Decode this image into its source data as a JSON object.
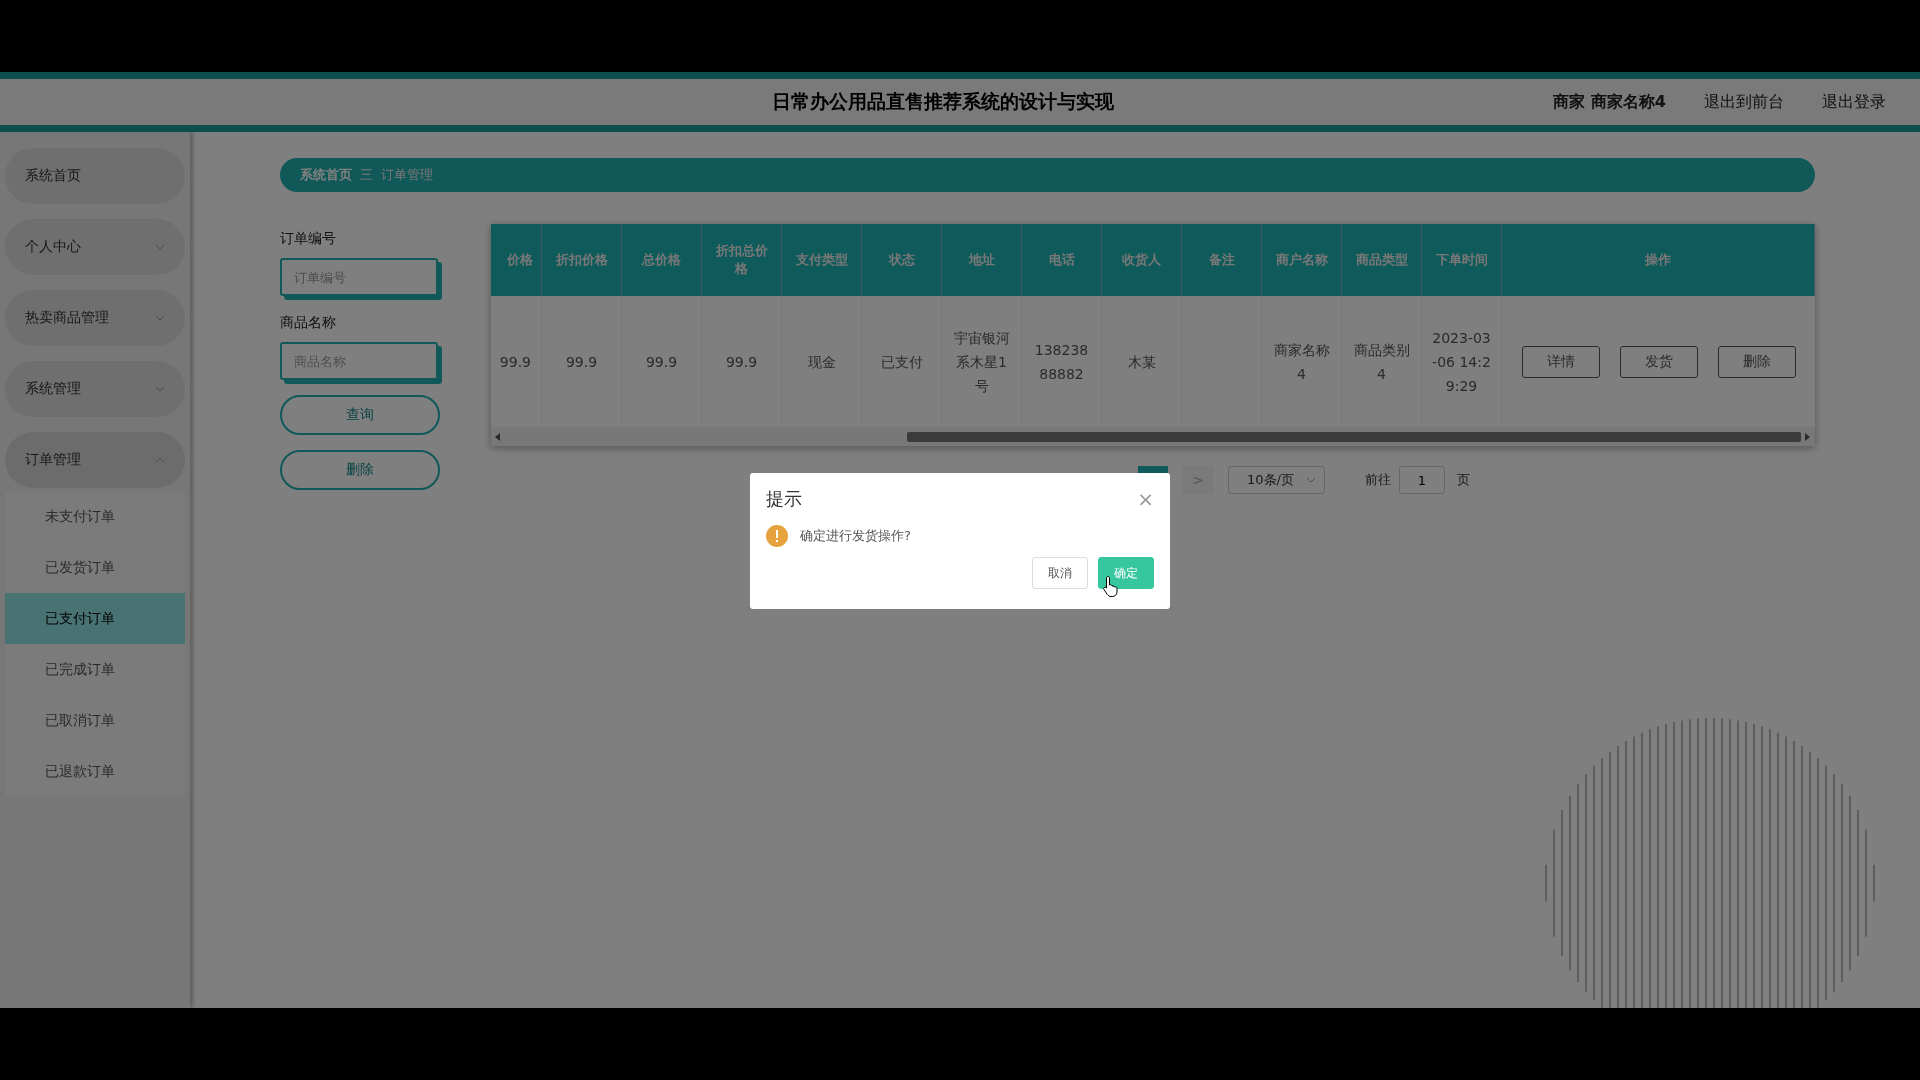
{
  "header": {
    "title": "日常办公用品直售推荐系统的设计与实现",
    "user": "商家 商家名称4",
    "links": [
      "退出到前台",
      "退出登录"
    ]
  },
  "sidebar": {
    "items": [
      {
        "label": "系统首页"
      },
      {
        "label": "个人中心",
        "expanded": false
      },
      {
        "label": "热卖商品管理",
        "expanded": false
      },
      {
        "label": "系统管理",
        "expanded": false
      },
      {
        "label": "订单管理",
        "expanded": true,
        "children": [
          {
            "label": "未支付订单",
            "selected": false
          },
          {
            "label": "已发货订单",
            "selected": false
          },
          {
            "label": "已支付订单",
            "selected": true
          },
          {
            "label": "已完成订单",
            "selected": false
          },
          {
            "label": "已取消订单",
            "selected": false
          },
          {
            "label": "已退款订单",
            "selected": false
          }
        ]
      }
    ]
  },
  "breadcrumb": [
    "系统首页",
    "三",
    "订单管理"
  ],
  "search": {
    "fields": [
      {
        "label": "订单编号",
        "placeholder": "订单编号"
      },
      {
        "label": "商品名称",
        "placeholder": "商品名称"
      }
    ],
    "buttons": [
      "查询",
      "删除"
    ]
  },
  "table": {
    "columns": [
      "价格",
      "折扣价格",
      "总价格",
      "折扣总价格",
      "支付类型",
      "状态",
      "地址",
      "电话",
      "收货人",
      "备注",
      "商户名称",
      "商品类型",
      "下单时间",
      "操作"
    ],
    "rows": [
      {
        "cells": [
          "99.9",
          "99.9",
          "99.9",
          "99.9",
          "现金",
          "已支付",
          "宇宙银河系木星1号",
          "13823888882",
          "木某",
          "",
          "商家名称4",
          "商品类别4",
          "2023-03-06 14:29:29"
        ],
        "actions": [
          "详情",
          "发货",
          "删除"
        ]
      }
    ]
  },
  "pagination": {
    "next": ">",
    "page_size": "10条/页",
    "goto_label": "前往",
    "goto_value": "1",
    "page_suffix": "页"
  },
  "dialog": {
    "title": "提示",
    "close": "×",
    "message": "确定进行发货操作?",
    "buttons": [
      {
        "label": "取消",
        "kind": "secondary"
      },
      {
        "label": "确定",
        "kind": "primary"
      }
    ]
  }
}
